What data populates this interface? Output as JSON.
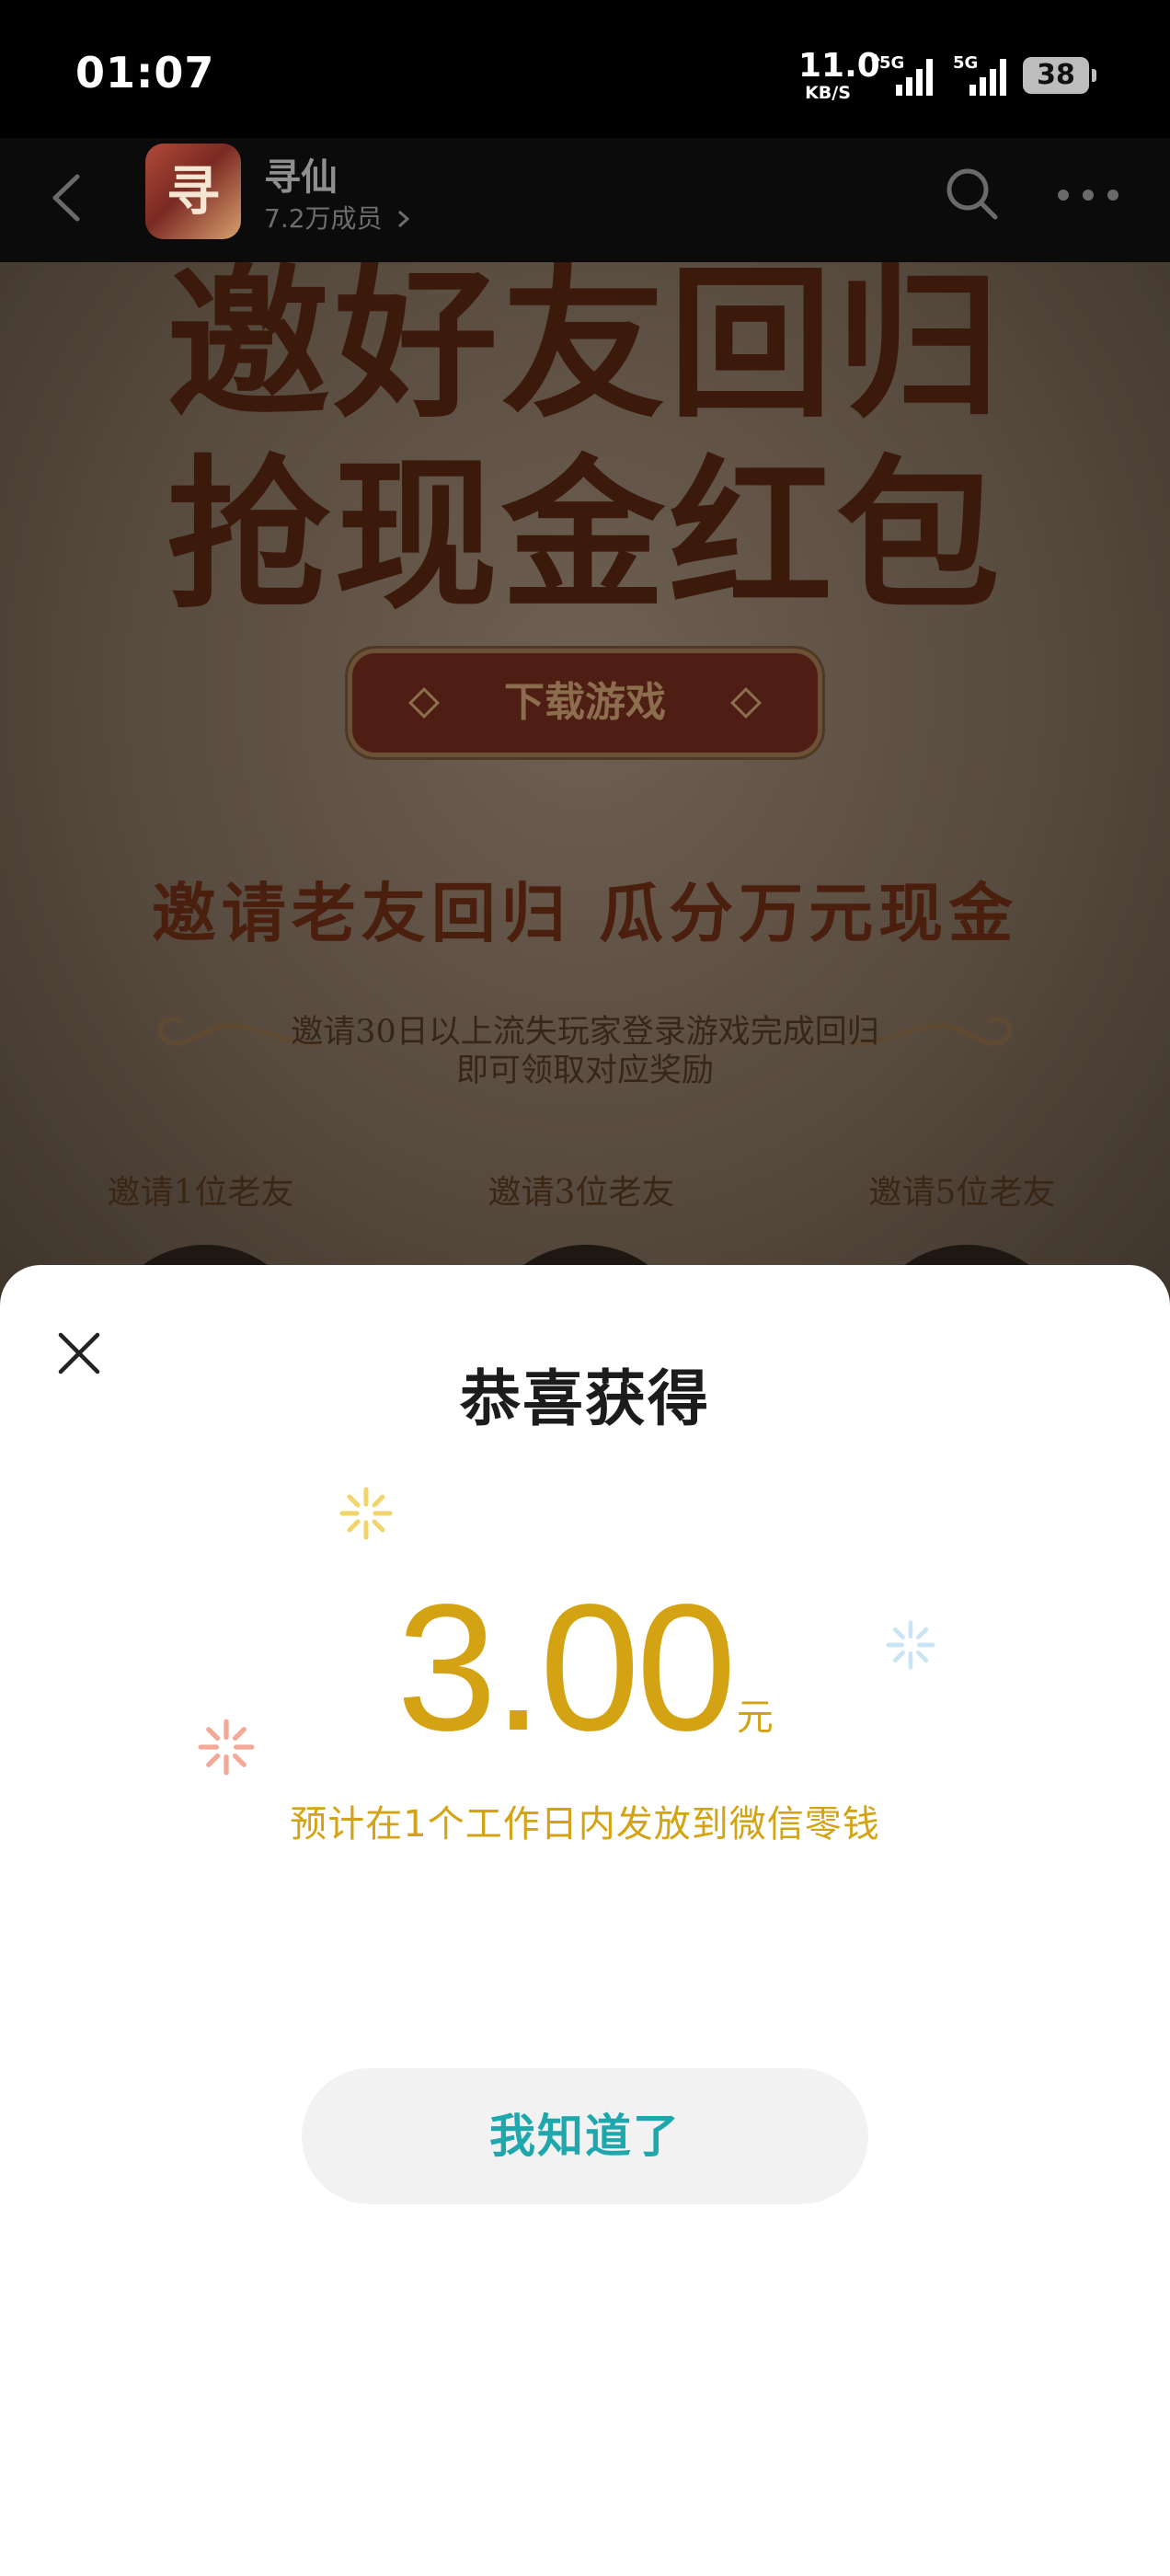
{
  "status_bar": {
    "time": "01:07",
    "net_speed_value": "11.0",
    "net_speed_unit": "KB/S",
    "signal_label_1": "5G",
    "signal_label_2": "5G",
    "battery": "38"
  },
  "header": {
    "group_name": "寻仙",
    "group_avatar_text": "寻仙",
    "member_count": "7.2万成员",
    "icons": [
      "back-icon",
      "search-icon",
      "more-icon",
      "chevron-right-icon"
    ]
  },
  "banner": {
    "title_line1": "邀好友回归",
    "title_line2": "抢现金红包",
    "download_button": "下载游戏",
    "headline": "邀请老友回归  瓜分万元现金",
    "desc_line1": "邀请30日以上流失玩家登录游戏完成回归",
    "desc_line2": "即可领取对应奖励",
    "tiers": [
      "邀请1位老友",
      "邀请3位老友",
      "邀请5位老友"
    ]
  },
  "dialog": {
    "title": "恭喜获得",
    "amount": "3.00",
    "unit": "元",
    "note": "预计在1个工作日内发放到微信零钱",
    "confirm_button": "我知道了",
    "colors": {
      "amount": "#d4a313",
      "button_text": "#1ea8ad",
      "button_bg": "#f2f2f2"
    }
  }
}
